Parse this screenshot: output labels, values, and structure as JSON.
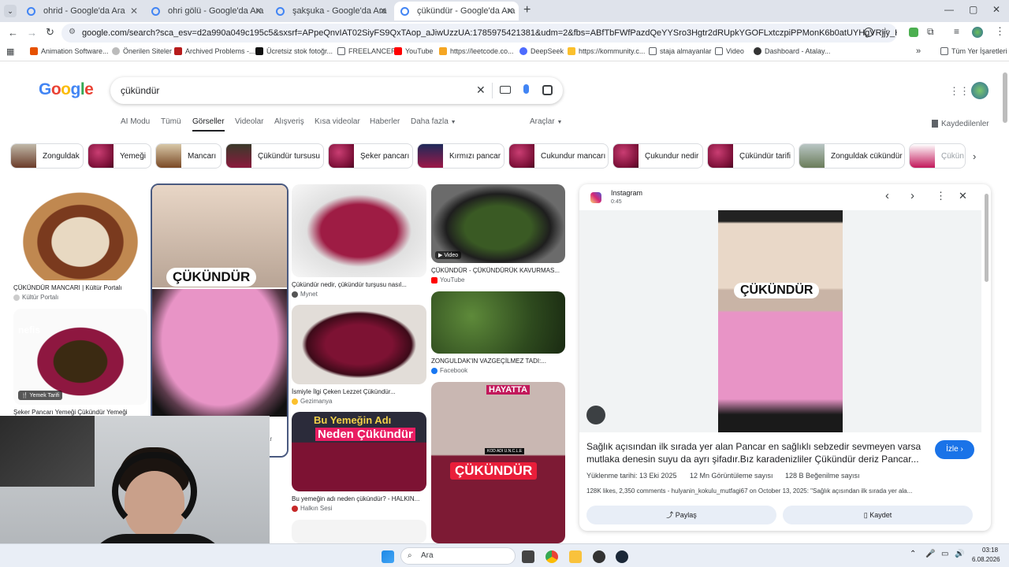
{
  "tabs": [
    {
      "title": "ohrid - Google'da Ara"
    },
    {
      "title": "ohri gölü - Google'da Ara"
    },
    {
      "title": "şakşuka - Google'da Ara"
    },
    {
      "title": "çükündür - Google'da Ara"
    }
  ],
  "url": "google.com/search?sca_esv=d2a990a049c195c5&sxsrf=APpeQnvIAT02SiyFS9QxTAop_aJiwUzzUA:1785975421381&udm=2&fbs=ABfTbFWfPazdQeYYSro3Hgtr2dRUpkYGOFLxtczpiPPMonK6b0atUYHgVRjjy_HDAjTEFQe2Eqp_HH8_C8qIZ-He...",
  "bookmarks": [
    "Animation Software...",
    "Önerilen Siteler",
    "Archived Problems -...",
    "Ücretsiz stok fotoğr...",
    "FREELANCER",
    "YouTube",
    "https://leetcode.co...",
    "DeepSeek",
    "https://kommunity.c...",
    "staja almayanlar",
    "Video",
    "Dashboard - Atalay..."
  ],
  "bookmarks_all": "Tüm Yer İşaretleri",
  "search": {
    "query": "çükündür"
  },
  "nav_tabs": [
    "AI Modu",
    "Tümü",
    "Görseller",
    "Videolar",
    "Alışveriş",
    "Kısa videolar",
    "Haberler",
    "Daha fazla",
    "Araçlar"
  ],
  "saved_label": "Kaydedilenler",
  "chips": [
    "Zonguldak",
    "Yemeği",
    "Mancarı",
    "Çükündür tursusu",
    "Şeker pancarı",
    "Kırmızı pancar",
    "Cukundur mancarı",
    "Çukundur nedir",
    "Çükündür tarifi",
    "Zonguldak cükündür",
    "Çükün"
  ],
  "results": [
    {
      "caption": "ÇÜKÜNDÜR MANCARI | Kültür Portalı",
      "source": "Kültür Portalı"
    },
    {
      "caption": "Şeker Pancarı Yemeği Çükündür Yemeği",
      "badge": "Yemek Tarifi"
    },
    {
      "overlay": "ÇÜKÜNDÜR"
    },
    {
      "caption": "Çükündür nedir, çükündür turşusu nasıl...",
      "source": "Mynet"
    },
    {
      "caption": "İsmiyle İlgi Çeken Lezzet Çükündür...",
      "source": "Gezimanya"
    },
    {
      "caption": "Bu yemeğin adı neden çükündür? - HALKIN...",
      "source": "Halkın Sesi",
      "overlay1": "Bu Yemeğin Adı",
      "overlay2": "Neden Çükündür"
    },
    {
      "caption": "ÇÜKÜNDÜR - ÇÜKÜNDÜRÜK KAVURMAS...",
      "source": "YouTube",
      "badge": "Video"
    },
    {
      "caption": "ZONGULDAK'IN VAZGEÇİLMEZ TADI:...",
      "source": "Facebook"
    },
    {
      "overlay": "ÇÜKÜNDÜR",
      "top": "HAYATTA",
      "kod": "KOD ADI U.N.C.L.E"
    }
  ],
  "panel": {
    "source": "Instagram",
    "duration": "0:45",
    "overlay": "ÇÜKÜNDÜR",
    "title": "Sağlık açısından ilk sırada yer alan Pancar en sağlıklı sebzedir sevmeyen varsa mutlaka denesin suyu da ayrı şifadır.Bız karadenizliler Çükündür deriz Pancar...",
    "watch": "İzle",
    "stats": [
      "Yüklenme tarihi: 13 Eki 2025",
      "12 Mn Görüntüleme sayısı",
      "128 B Beğenilme sayısı"
    ],
    "comment": "128K likes, 2,350 comments - hulyanin_kokulu_mutfagi67 on October 13, 2025: \"Sağlık açısından ilk sırada yer ala...",
    "share": "Paylaş",
    "save": "Kaydet"
  },
  "taskbar": {
    "search": "Ara",
    "time": "03:18",
    "date": "6.08.2026"
  },
  "colors": {
    "accent": "#1a73e8",
    "beet": "#9c1847",
    "google_blue": "#4285f4"
  }
}
